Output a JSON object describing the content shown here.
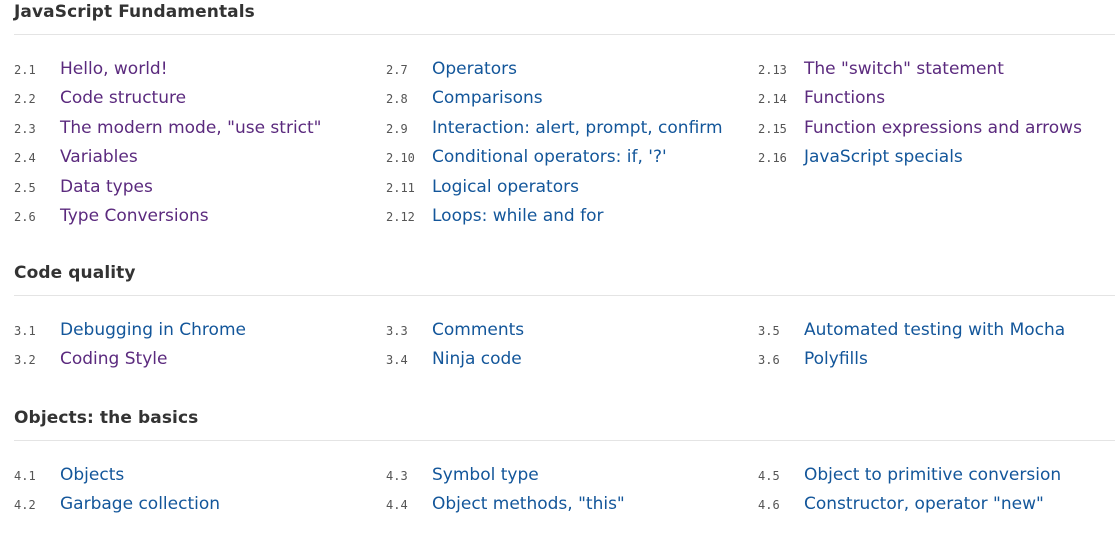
{
  "colors": {
    "link": "#13569a",
    "visited": "#5b2a7e",
    "heading": "#333333",
    "number": "#555555",
    "rule": "#e4e4e4"
  },
  "sections": [
    {
      "title": "JavaScript Fundamentals",
      "columns": [
        [
          {
            "num": "2.1",
            "label": "Hello, world!",
            "visited": true
          },
          {
            "num": "2.2",
            "label": "Code structure",
            "visited": true
          },
          {
            "num": "2.3",
            "label": "The modern mode, \"use strict\"",
            "visited": true
          },
          {
            "num": "2.4",
            "label": "Variables",
            "visited": true
          },
          {
            "num": "2.5",
            "label": "Data types",
            "visited": true
          },
          {
            "num": "2.6",
            "label": "Type Conversions",
            "visited": true
          }
        ],
        [
          {
            "num": "2.7",
            "label": "Operators",
            "visited": false
          },
          {
            "num": "2.8",
            "label": "Comparisons",
            "visited": false
          },
          {
            "num": "2.9",
            "label": "Interaction: alert, prompt, confirm",
            "visited": false
          },
          {
            "num": "2.10",
            "label": "Conditional operators: if, '?'",
            "visited": false
          },
          {
            "num": "2.11",
            "label": "Logical operators",
            "visited": false
          },
          {
            "num": "2.12",
            "label": "Loops: while and for",
            "visited": false
          }
        ],
        [
          {
            "num": "2.13",
            "label": "The \"switch\" statement",
            "visited": true
          },
          {
            "num": "2.14",
            "label": "Functions",
            "visited": true
          },
          {
            "num": "2.15",
            "label": "Function expressions and arrows",
            "visited": true
          },
          {
            "num": "2.16",
            "label": "JavaScript specials",
            "visited": false
          }
        ]
      ]
    },
    {
      "title": "Code quality",
      "columns": [
        [
          {
            "num": "3.1",
            "label": "Debugging in Chrome",
            "visited": false
          },
          {
            "num": "3.2",
            "label": "Coding Style",
            "visited": true
          }
        ],
        [
          {
            "num": "3.3",
            "label": "Comments",
            "visited": false
          },
          {
            "num": "3.4",
            "label": "Ninja code",
            "visited": false
          }
        ],
        [
          {
            "num": "3.5",
            "label": "Automated testing with Mocha",
            "visited": false
          },
          {
            "num": "3.6",
            "label": "Polyfills",
            "visited": false
          }
        ]
      ]
    },
    {
      "title": "Objects: the basics",
      "columns": [
        [
          {
            "num": "4.1",
            "label": "Objects",
            "visited": false
          },
          {
            "num": "4.2",
            "label": "Garbage collection",
            "visited": false
          }
        ],
        [
          {
            "num": "4.3",
            "label": "Symbol type",
            "visited": false
          },
          {
            "num": "4.4",
            "label": "Object methods, \"this\"",
            "visited": false
          }
        ],
        [
          {
            "num": "4.5",
            "label": "Object to primitive conversion",
            "visited": false
          },
          {
            "num": "4.6",
            "label": "Constructor, operator \"new\"",
            "visited": false
          }
        ]
      ]
    }
  ]
}
